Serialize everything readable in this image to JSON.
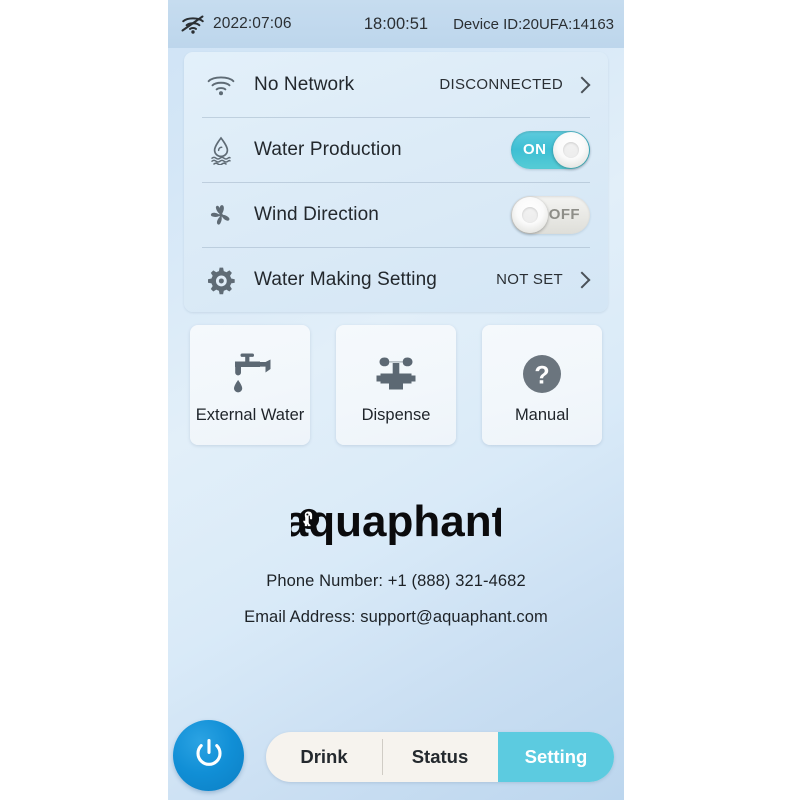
{
  "statusbar": {
    "wifi_icon": "wifi-off-icon",
    "date": "2022:07:06",
    "time": "18:00:51",
    "device_id": "Device ID:20UFA:14163"
  },
  "settings": {
    "rows": [
      {
        "icon": "wifi-icon",
        "label": "No Network",
        "status": "DISCONNECTED",
        "chevron": "chevron-right-icon"
      },
      {
        "icon": "water-drop-waves-icon",
        "label": "Water Production",
        "toggle_state": "on",
        "toggle_label": "ON"
      },
      {
        "icon": "fan-icon",
        "label": "Wind Direction",
        "toggle_state": "off",
        "toggle_label": "OFF"
      },
      {
        "icon": "gear-icon",
        "label": "Water Making Setting",
        "status": "NOT SET",
        "chevron": "chevron-right-icon"
      }
    ]
  },
  "cards": [
    {
      "icon": "faucet-drip-icon",
      "label": "External Water"
    },
    {
      "icon": "valve-tap-icon",
      "label": "Dispense"
    },
    {
      "icon": "question-circle-icon",
      "label": "Manual"
    }
  ],
  "brand": {
    "logo_text": "aquaphant",
    "logo_mark": "elephant-icon"
  },
  "contact": {
    "phone": "Phone Number: +1 (888) 321-4682",
    "email": "Email Address: support@aquaphant.com"
  },
  "bottom": {
    "power_icon": "power-icon",
    "tabs": [
      {
        "label": "Drink",
        "active": false
      },
      {
        "label": "Status",
        "active": false
      },
      {
        "label": "Setting",
        "active": true
      }
    ]
  },
  "colors": {
    "accent_cyan": "#5ccbe0",
    "power_blue": "#118fd6",
    "toggle_on": "#3ebfd4",
    "toggle_off": "#e8e8e4",
    "icon_gray": "#5f6b75"
  }
}
